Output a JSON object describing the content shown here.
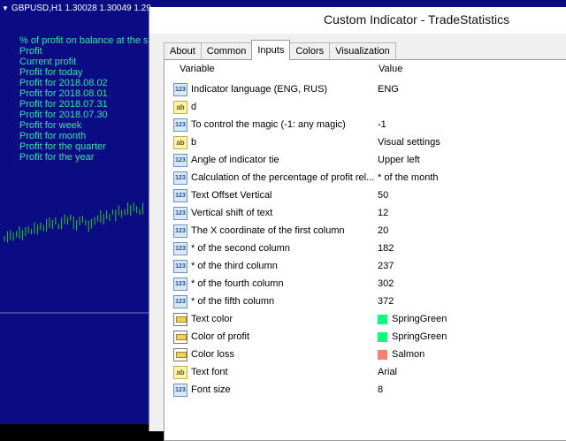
{
  "chart": {
    "title": "GBPUSD,H1  1.30028 1.30049 1.29",
    "stats_lines": [
      "% of profit on balance at the s",
      "Profit",
      "Current profit",
      "Profit for today",
      "Profit for 2018.08.02",
      "Profit for 2018.08.01",
      "Profit for 2018.07.31",
      "Profit for 2018.07.30",
      "Profit for week",
      "Profit for month",
      "Profit for the quarter",
      "Profit for the year"
    ],
    "colors": {
      "background": "#0b0b83",
      "text": "#28e8a0",
      "candles": "#22cc22"
    }
  },
  "dialog": {
    "title": "Custom Indicator - TradeStatistics",
    "tabs": [
      {
        "label": "About"
      },
      {
        "label": "Common"
      },
      {
        "label": "Inputs",
        "active": true
      },
      {
        "label": "Colors"
      },
      {
        "label": "Visualization"
      }
    ],
    "columns": {
      "variable": "Variable",
      "value": "Value"
    },
    "params": [
      {
        "icon": "int",
        "name": "Indicator language (ENG, RUS)",
        "value": "ENG"
      },
      {
        "icon": "string",
        "name": "d",
        "value": ""
      },
      {
        "icon": "int",
        "name": "To control the magic (-1: any magic)",
        "value": "-1"
      },
      {
        "icon": "string",
        "name": "b",
        "value": "Visual settings"
      },
      {
        "icon": "int",
        "name": "Angle of indicator tie",
        "value": "Upper left"
      },
      {
        "icon": "int",
        "name": "Calculation of the percentage of profit rel...",
        "value": "* of the month"
      },
      {
        "icon": "int",
        "name": "Text Offset Vertical",
        "value": "50"
      },
      {
        "icon": "int",
        "name": "Vertical shift of text",
        "value": "12"
      },
      {
        "icon": "int",
        "name": "The X coordinate of the first column",
        "value": "20"
      },
      {
        "icon": "int",
        "name": "* of the second column",
        "value": "182"
      },
      {
        "icon": "int",
        "name": "* of the third column",
        "value": "237"
      },
      {
        "icon": "int",
        "name": "* of the fourth column",
        "value": "302"
      },
      {
        "icon": "int",
        "name": "* of the fifth column",
        "value": "372"
      },
      {
        "icon": "color",
        "name": "Text color",
        "value": "SpringGreen",
        "swatch": "#00ff7f"
      },
      {
        "icon": "color",
        "name": "Color of profit",
        "value": "SpringGreen",
        "swatch": "#00ff7f"
      },
      {
        "icon": "color",
        "name": "Color loss",
        "value": "Salmon",
        "swatch": "#fa8072"
      },
      {
        "icon": "string",
        "name": "Text font",
        "value": "Arial"
      },
      {
        "icon": "int",
        "name": "Font size",
        "value": "8"
      }
    ]
  }
}
